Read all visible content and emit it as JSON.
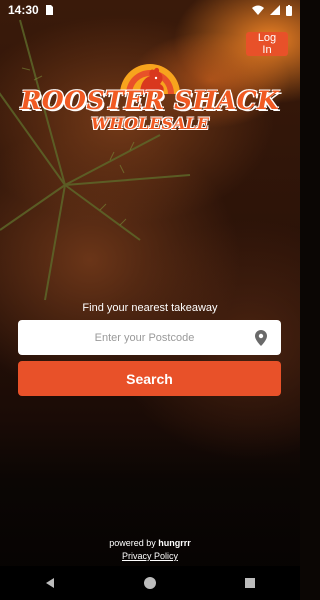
{
  "status_bar": {
    "time": "14:30"
  },
  "header": {
    "login_label": "Log In"
  },
  "logo": {
    "line1": "ROOSTER SHACK",
    "line2": "WHOLESALE"
  },
  "search": {
    "prompt": "Find your nearest takeaway",
    "placeholder": "Enter your Postcode",
    "value": "",
    "button_label": "Search"
  },
  "footer": {
    "powered_by": "powered by",
    "brand": "hungrrr",
    "privacy_label": "Privacy Policy"
  },
  "colors": {
    "accent": "#e85129",
    "logo_orange": "#f15a22",
    "logo_sun": "#f7a41d"
  },
  "icons": {
    "pin": "location-pin-icon",
    "back": "back-triangle-icon",
    "home": "home-circle-icon",
    "recents": "recents-square-icon"
  }
}
